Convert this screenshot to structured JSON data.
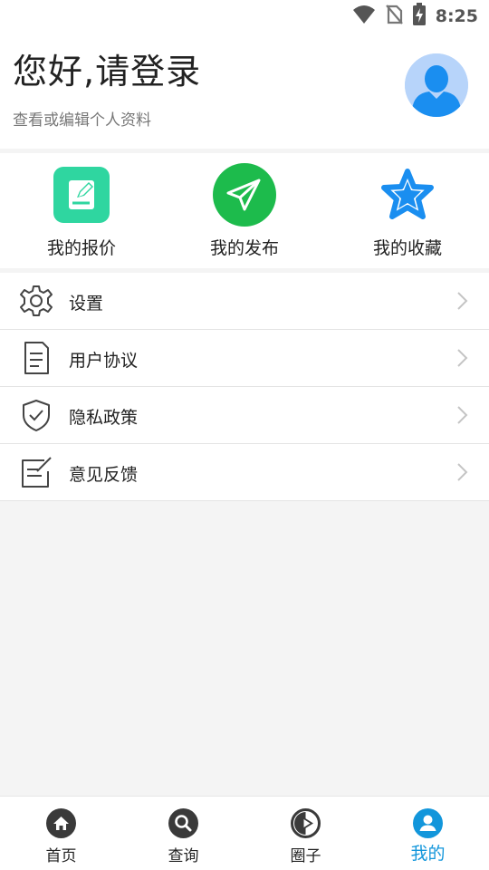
{
  "status_bar": {
    "time": "8:25",
    "icons": [
      "wifi-icon",
      "no-sim-icon",
      "battery-charging-icon"
    ]
  },
  "profile": {
    "greeting": "您好,请登录",
    "subtitle": "查看或编辑个人资料",
    "avatar_icon": "user-avatar-icon",
    "avatar_color": "#b7d4fa",
    "avatar_figure_color": "#1a8ef0"
  },
  "quick_actions": [
    {
      "label": "我的报价",
      "icon": "edit-note-icon",
      "color": "#2fd6a0"
    },
    {
      "label": "我的发布",
      "icon": "paper-plane-icon",
      "color": "#1dbb4c"
    },
    {
      "label": "我的收藏",
      "icon": "star-icon",
      "color": "#1a8ef0"
    }
  ],
  "menu": [
    {
      "label": "设置",
      "icon": "gear-icon"
    },
    {
      "label": "用户协议",
      "icon": "document-icon"
    },
    {
      "label": "隐私政策",
      "icon": "shield-check-icon"
    },
    {
      "label": "意见反馈",
      "icon": "feedback-edit-icon"
    }
  ],
  "bottom_nav": [
    {
      "label": "首页",
      "icon": "home-icon",
      "active": false
    },
    {
      "label": "查询",
      "icon": "search-icon",
      "active": false
    },
    {
      "label": "圈子",
      "icon": "circle-play-icon",
      "active": false
    },
    {
      "label": "我的",
      "icon": "person-icon",
      "active": true
    }
  ],
  "colors": {
    "accent": "#1296db",
    "nav_icon": "#3a3a3a",
    "background": "#f4f4f4"
  }
}
